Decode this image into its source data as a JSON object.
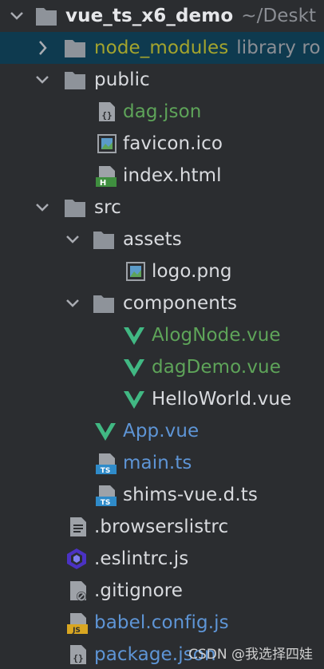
{
  "project": {
    "name": "vue_ts_x6_demo",
    "path_hint": "~/Deskt"
  },
  "tree": {
    "node_modules": {
      "label": "node_modules",
      "hint": "library ro"
    },
    "public": {
      "label": "public",
      "children": [
        "dag.json",
        "favicon.ico",
        "index.html"
      ]
    },
    "src": {
      "label": "src",
      "assets": {
        "label": "assets",
        "children": [
          "logo.png"
        ]
      },
      "components": {
        "label": "components",
        "children": [
          "AlogNode.vue",
          "dagDemo.vue",
          "HelloWorld.vue"
        ]
      },
      "files": [
        "App.vue",
        "main.ts",
        "shims-vue.d.ts"
      ]
    },
    "root_files": [
      ".browserslistrc",
      ".eslintrc.js",
      ".gitignore",
      "babel.config.js",
      "package.json"
    ]
  },
  "colors": {
    "background": "#2b2d30",
    "selected_row": "#0e3a4f",
    "modified_green": "#5ea459",
    "changed_blue": "#5e95d6",
    "excluded_olive": "#a4a42d",
    "folder": "#8e939a",
    "vue_green": "#41b883"
  },
  "icons": {
    "folder": "folder-icon",
    "json": "json-file-icon",
    "image": "image-file-icon",
    "html": "html-file-icon",
    "vue": "vue-file-icon",
    "ts": "typescript-file-icon",
    "text": "text-file-icon",
    "eslint": "eslint-icon",
    "gitignore": "gitignore-icon",
    "js": "javascript-file-icon"
  },
  "watermark": "CSDN @我选择四娃"
}
